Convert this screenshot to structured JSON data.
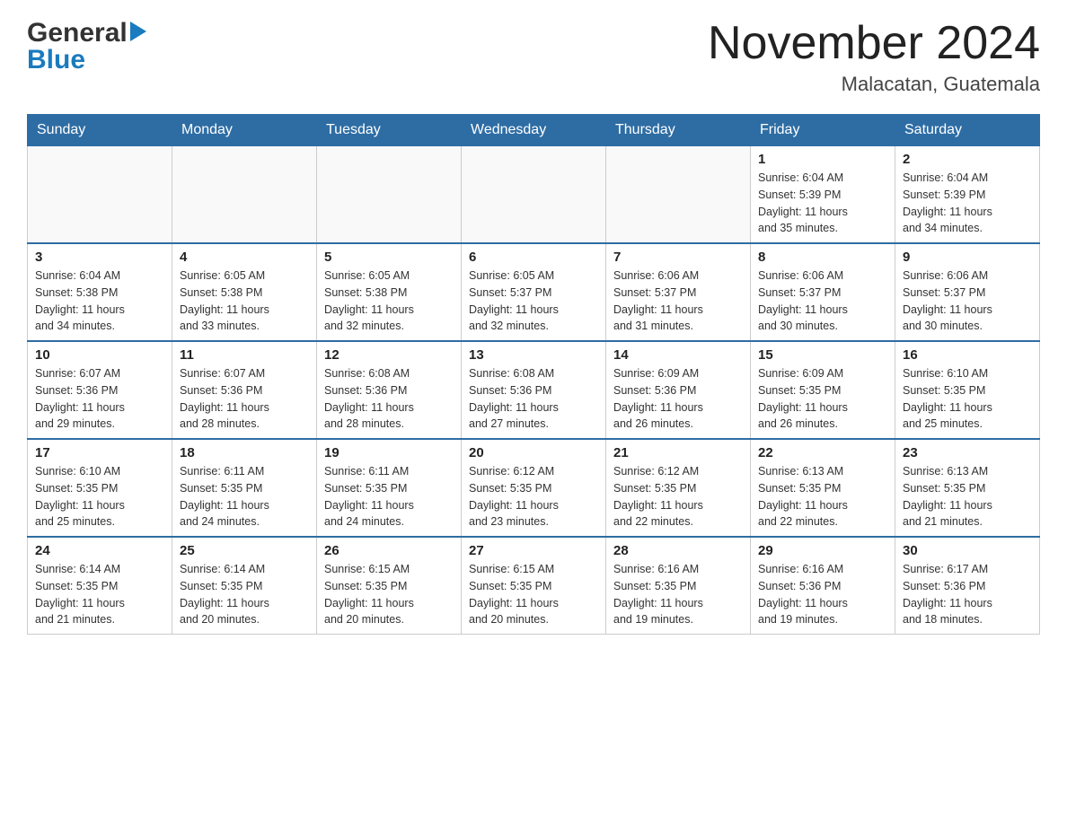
{
  "header": {
    "logo_general": "General",
    "logo_blue": "Blue",
    "month_title": "November 2024",
    "location": "Malacatan, Guatemala"
  },
  "weekdays": [
    "Sunday",
    "Monday",
    "Tuesday",
    "Wednesday",
    "Thursday",
    "Friday",
    "Saturday"
  ],
  "weeks": [
    [
      {
        "day": "",
        "info": ""
      },
      {
        "day": "",
        "info": ""
      },
      {
        "day": "",
        "info": ""
      },
      {
        "day": "",
        "info": ""
      },
      {
        "day": "",
        "info": ""
      },
      {
        "day": "1",
        "info": "Sunrise: 6:04 AM\nSunset: 5:39 PM\nDaylight: 11 hours\nand 35 minutes."
      },
      {
        "day": "2",
        "info": "Sunrise: 6:04 AM\nSunset: 5:39 PM\nDaylight: 11 hours\nand 34 minutes."
      }
    ],
    [
      {
        "day": "3",
        "info": "Sunrise: 6:04 AM\nSunset: 5:38 PM\nDaylight: 11 hours\nand 34 minutes."
      },
      {
        "day": "4",
        "info": "Sunrise: 6:05 AM\nSunset: 5:38 PM\nDaylight: 11 hours\nand 33 minutes."
      },
      {
        "day": "5",
        "info": "Sunrise: 6:05 AM\nSunset: 5:38 PM\nDaylight: 11 hours\nand 32 minutes."
      },
      {
        "day": "6",
        "info": "Sunrise: 6:05 AM\nSunset: 5:37 PM\nDaylight: 11 hours\nand 32 minutes."
      },
      {
        "day": "7",
        "info": "Sunrise: 6:06 AM\nSunset: 5:37 PM\nDaylight: 11 hours\nand 31 minutes."
      },
      {
        "day": "8",
        "info": "Sunrise: 6:06 AM\nSunset: 5:37 PM\nDaylight: 11 hours\nand 30 minutes."
      },
      {
        "day": "9",
        "info": "Sunrise: 6:06 AM\nSunset: 5:37 PM\nDaylight: 11 hours\nand 30 minutes."
      }
    ],
    [
      {
        "day": "10",
        "info": "Sunrise: 6:07 AM\nSunset: 5:36 PM\nDaylight: 11 hours\nand 29 minutes."
      },
      {
        "day": "11",
        "info": "Sunrise: 6:07 AM\nSunset: 5:36 PM\nDaylight: 11 hours\nand 28 minutes."
      },
      {
        "day": "12",
        "info": "Sunrise: 6:08 AM\nSunset: 5:36 PM\nDaylight: 11 hours\nand 28 minutes."
      },
      {
        "day": "13",
        "info": "Sunrise: 6:08 AM\nSunset: 5:36 PM\nDaylight: 11 hours\nand 27 minutes."
      },
      {
        "day": "14",
        "info": "Sunrise: 6:09 AM\nSunset: 5:36 PM\nDaylight: 11 hours\nand 26 minutes."
      },
      {
        "day": "15",
        "info": "Sunrise: 6:09 AM\nSunset: 5:35 PM\nDaylight: 11 hours\nand 26 minutes."
      },
      {
        "day": "16",
        "info": "Sunrise: 6:10 AM\nSunset: 5:35 PM\nDaylight: 11 hours\nand 25 minutes."
      }
    ],
    [
      {
        "day": "17",
        "info": "Sunrise: 6:10 AM\nSunset: 5:35 PM\nDaylight: 11 hours\nand 25 minutes."
      },
      {
        "day": "18",
        "info": "Sunrise: 6:11 AM\nSunset: 5:35 PM\nDaylight: 11 hours\nand 24 minutes."
      },
      {
        "day": "19",
        "info": "Sunrise: 6:11 AM\nSunset: 5:35 PM\nDaylight: 11 hours\nand 24 minutes."
      },
      {
        "day": "20",
        "info": "Sunrise: 6:12 AM\nSunset: 5:35 PM\nDaylight: 11 hours\nand 23 minutes."
      },
      {
        "day": "21",
        "info": "Sunrise: 6:12 AM\nSunset: 5:35 PM\nDaylight: 11 hours\nand 22 minutes."
      },
      {
        "day": "22",
        "info": "Sunrise: 6:13 AM\nSunset: 5:35 PM\nDaylight: 11 hours\nand 22 minutes."
      },
      {
        "day": "23",
        "info": "Sunrise: 6:13 AM\nSunset: 5:35 PM\nDaylight: 11 hours\nand 21 minutes."
      }
    ],
    [
      {
        "day": "24",
        "info": "Sunrise: 6:14 AM\nSunset: 5:35 PM\nDaylight: 11 hours\nand 21 minutes."
      },
      {
        "day": "25",
        "info": "Sunrise: 6:14 AM\nSunset: 5:35 PM\nDaylight: 11 hours\nand 20 minutes."
      },
      {
        "day": "26",
        "info": "Sunrise: 6:15 AM\nSunset: 5:35 PM\nDaylight: 11 hours\nand 20 minutes."
      },
      {
        "day": "27",
        "info": "Sunrise: 6:15 AM\nSunset: 5:35 PM\nDaylight: 11 hours\nand 20 minutes."
      },
      {
        "day": "28",
        "info": "Sunrise: 6:16 AM\nSunset: 5:35 PM\nDaylight: 11 hours\nand 19 minutes."
      },
      {
        "day": "29",
        "info": "Sunrise: 6:16 AM\nSunset: 5:36 PM\nDaylight: 11 hours\nand 19 minutes."
      },
      {
        "day": "30",
        "info": "Sunrise: 6:17 AM\nSunset: 5:36 PM\nDaylight: 11 hours\nand 18 minutes."
      }
    ]
  ]
}
